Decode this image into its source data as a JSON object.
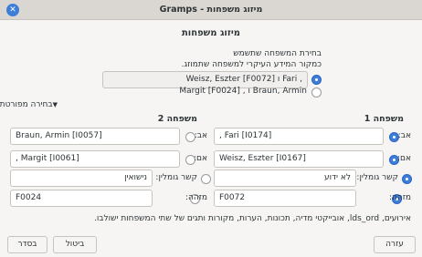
{
  "window": {
    "title": "מיזוג משפחות - Gramps"
  },
  "dialog_heading": "מיזוג משפחות",
  "primary_section": {
    "text_line1": "בחירת המשפחה שתשמש",
    "text_line2": "כמקור המידע העיקרי למשפחה שתמוזג.",
    "option1": ", Fari ו Weisz, Eszter [F0072]",
    "option2": "Braun, Armin ו , Margit [F0024]"
  },
  "detailed_selection_label": "בחירה מפורטת",
  "columns": {
    "family1": "משפחה 1",
    "family2": "משפחה 2"
  },
  "labels": {
    "father": "אב:",
    "mother": "אם:",
    "relationship": "קשר גומלין:",
    "id": "מזהה:"
  },
  "family1": {
    "father": ", Fari [I0174]",
    "mother": "Weisz, Eszter [I0167]",
    "relationship": "לא ידוע",
    "id": "F0072"
  },
  "family2": {
    "father": "Braun, Armin [I0057]",
    "mother": ", Margit [I0061]",
    "relationship": "נישואין",
    "id": "F0024"
  },
  "note": "אירועים, lds_ord, אובייקטי מדיה, תכונות, הערות, מקורות ותגים של שתי המשפחות ישולבו.",
  "buttons": {
    "help": "עזרה",
    "cancel": "ביטול",
    "ok": "בסדר"
  }
}
